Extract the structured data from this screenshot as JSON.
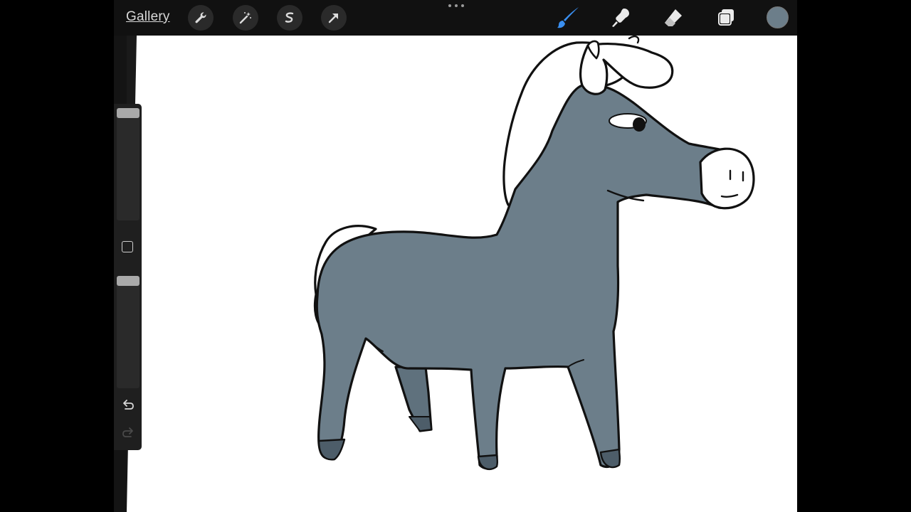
{
  "topbar": {
    "gallery_label": "Gallery",
    "left_tools": [
      {
        "name": "actions",
        "icon": "wrench-icon"
      },
      {
        "name": "adjustments",
        "icon": "magic-wand-icon"
      },
      {
        "name": "selection",
        "icon": "selection-s-icon"
      },
      {
        "name": "transform",
        "icon": "arrow-cursor-icon"
      }
    ],
    "right_tools": [
      {
        "name": "brush",
        "icon": "brush-icon",
        "active": true
      },
      {
        "name": "smudge",
        "icon": "smudge-icon"
      },
      {
        "name": "eraser",
        "icon": "eraser-icon"
      },
      {
        "name": "layers",
        "icon": "layers-icon"
      }
    ],
    "more_icon": "ellipsis-icon"
  },
  "colors": {
    "current_color": "#6c7e8a",
    "active_tool_color": "#3a8ff0",
    "horse_body": "#6c7e8a",
    "horse_hooves": "#4d5d69",
    "outline": "#111111"
  },
  "sidebar": {
    "brush_size_slider": "size-slider",
    "modify_button_icon": "square-icon",
    "opacity_slider": "opacity-slider",
    "undo_icon": "undo-icon",
    "redo_icon": "redo-icon"
  },
  "canvas": {
    "drawing": "cartoon-horse"
  }
}
